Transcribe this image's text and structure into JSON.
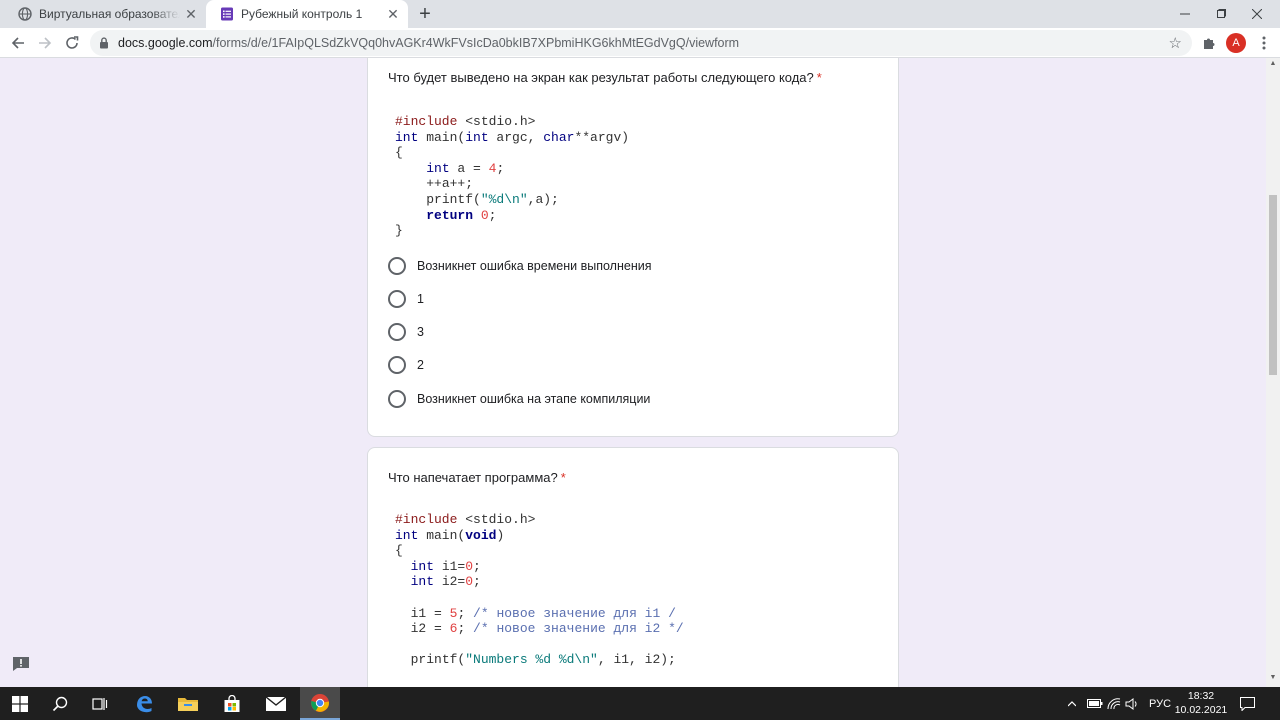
{
  "browser": {
    "tabs": [
      {
        "title": "Виртуальная образовательная среда",
        "active": false
      },
      {
        "title": "Рубежный контроль 1",
        "active": true
      }
    ],
    "url_host": "docs.google.com",
    "url_path": "/forms/d/e/1FAIpQLSdZkVQq0hvAGKr4WkFVsIcDa0bkIB7XPbmiHKG6khMtEGdVgQ/viewform",
    "profile_initial": "A",
    "profile_color": "#d93025"
  },
  "questions": [
    {
      "title": "Что будет выведено на экран как результат работы следующего кода?",
      "required_mark": "*",
      "options": [
        "Возникнет ошибка времени выполнения",
        "1",
        "3",
        "2",
        "Возникнет ошибка на этапе компиляции"
      ]
    },
    {
      "title": "Что напечатает программа?",
      "required_mark": "*"
    }
  ],
  "code1": {
    "include": "#include",
    "header": " <stdio.h>",
    "t_int": "int",
    "t_main": " main(",
    "t_int2": "int",
    "t_argc": " argc, ",
    "t_char": "char",
    "t_argv": "**argv)",
    "brace_open": "{",
    "s1_int": "int",
    "s1_rest": " a = ",
    "s1_num": "4",
    "s1_end": ";",
    "s2": "++a++;",
    "s3_a": "printf(",
    "s3_str": "\"%d\\n\"",
    "s3_b": ",a);",
    "s4_ret": "return",
    "s4_num": " 0",
    "s4_end": ";",
    "brace_close": "}"
  },
  "code2": {
    "include": "#include",
    "header": " <stdio.h>",
    "t_int": "int",
    "t_main": " main(",
    "t_void": "void",
    "t_close": ")",
    "brace_open": "{",
    "d1_int": "int",
    "d1_a": " i1=",
    "d1_num": "0",
    "d1_end": ";",
    "d2_int": "int",
    "d2_a": " i2=",
    "d2_num": "0",
    "d2_end": ";",
    "a1_a": "i1 = ",
    "a1_num": "5",
    "a1_b": "; ",
    "a1_cmt": "/* новое значение для i1 /",
    "a2_a": "i2 = ",
    "a2_num": "6",
    "a2_b": "; ",
    "a2_cmt": "/* новое значение для i2 */",
    "p_a": "printf(",
    "p_str": "\"Numbers %d %d\\n\"",
    "p_b": ", i1, i2);"
  },
  "taskbar": {
    "language": "РУС",
    "time": "18:32",
    "date": "10.02.2021"
  }
}
